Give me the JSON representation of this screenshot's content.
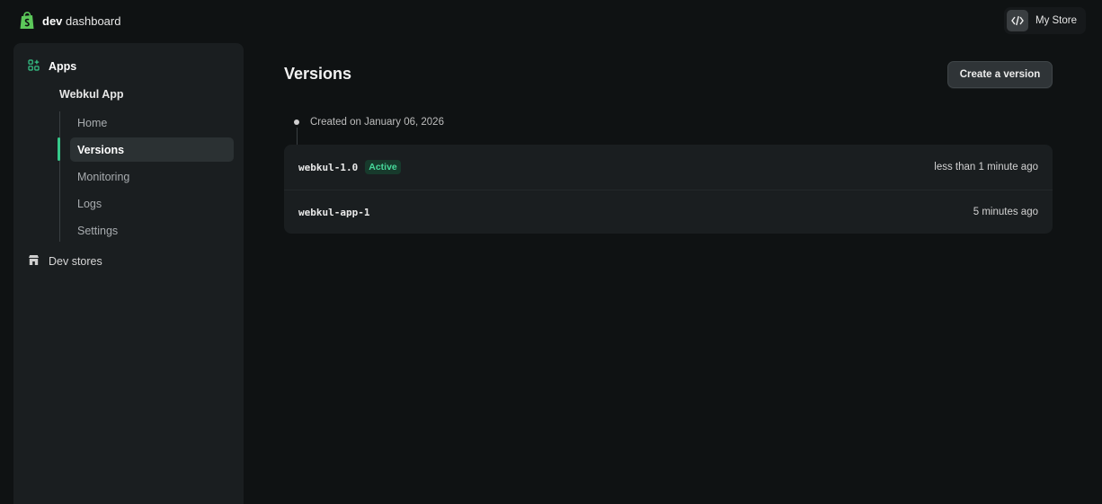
{
  "brand": {
    "title_bold": "dev",
    "title_rest": " dashboard"
  },
  "header": {
    "store_label": "My Store"
  },
  "sidebar": {
    "apps_label": "Apps",
    "app_name": "Webkul App",
    "items": [
      {
        "label": "Home"
      },
      {
        "label": "Versions"
      },
      {
        "label": "Monitoring"
      },
      {
        "label": "Logs"
      },
      {
        "label": "Settings"
      }
    ],
    "active_item": "Versions",
    "dev_stores_label": "Dev stores"
  },
  "main": {
    "title": "Versions",
    "create_button_label": "Create a version",
    "timeline_label": "Created on January 06, 2026",
    "versions": [
      {
        "name": "webkul-1.0",
        "badge": "Active",
        "time": "less than 1 minute ago"
      },
      {
        "name": "webkul-app-1",
        "badge": "",
        "time": "5 minutes ago"
      }
    ]
  },
  "colors": {
    "background": "#0f1213",
    "panel": "#1a1e20",
    "accent_green": "#36c98a",
    "brand_green": "#5cc85a"
  },
  "icons": {
    "brand": "shopify-bag-icon",
    "store_switch": "code-icon",
    "apps": "apps-grid-icon",
    "dev_stores": "store-icon"
  }
}
